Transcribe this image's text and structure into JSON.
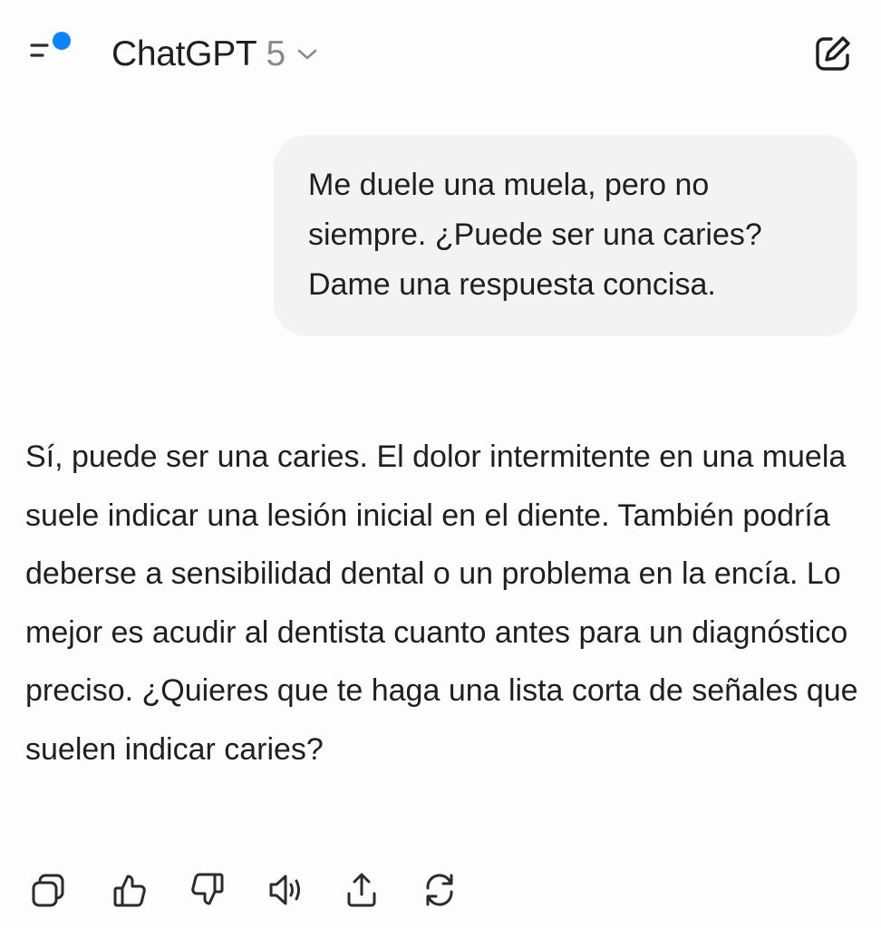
{
  "header": {
    "model_name": "ChatGPT",
    "model_version": "5"
  },
  "conversation": {
    "user_message": "Me duele una muela, pero no siempre. ¿Puede ser una caries? Dame una respuesta concisa.",
    "assistant_message": "Sí, puede ser una caries. El dolor intermitente en una muela suele indicar una lesión inicial en el diente. También podría deberse a sensibilidad dental o un problema en la encía. Lo mejor es acudir al dentista cuanto antes para un diagnóstico preciso. ¿Quieres que te haga una lista corta de señales que suelen indicar caries?"
  },
  "icons": {
    "menu": "sidebar-menu-icon",
    "notification_dot_color": "#0a84ff",
    "chevron": "chevron-down-icon",
    "new_chat": "edit-icon",
    "actions": [
      "copy-icon",
      "thumbs-up-icon",
      "thumbs-down-icon",
      "read-aloud-icon",
      "share-icon",
      "regenerate-icon"
    ]
  },
  "colors": {
    "background": "#fdfdfd",
    "user_bubble": "#f3f3f3",
    "text": "#1f1f1f",
    "muted": "#8a8a8a",
    "accent": "#0a84ff"
  }
}
